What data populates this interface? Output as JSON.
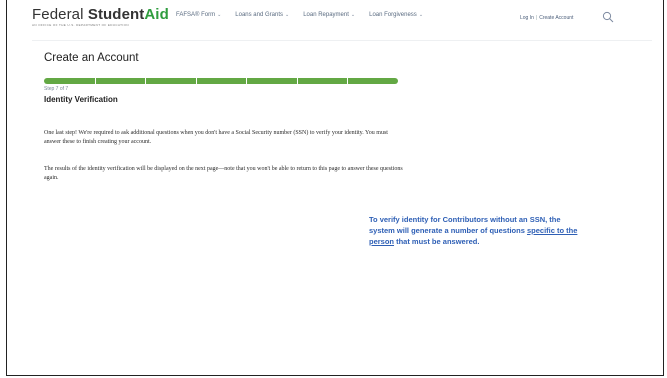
{
  "header": {
    "logo_part1": "Federal",
    "logo_part2": "Student",
    "logo_part3": "Aid",
    "logo_tagline": "AN OFFICE OF THE U.S. DEPARTMENT OF EDUCATION",
    "nav": [
      {
        "label": "FAFSA® Form"
      },
      {
        "label": "Loans and Grants"
      },
      {
        "label": "Loan Repayment"
      },
      {
        "label": "Loan Forgiveness"
      }
    ],
    "login_label": "Log In",
    "separator": "|",
    "create_account_label": "Create Account",
    "search_icon": "search-icon"
  },
  "page": {
    "title": "Create an Account",
    "progress": {
      "current": 7,
      "total": 7
    },
    "step_label": "Step 7 of 7",
    "section_title": "Identity Verification",
    "paragraph1": "One last step! We're required to ask additional questions when you don't have a Social Security number (SSN) to verify your identity. You must answer these to finish creating your account.",
    "paragraph2": "The results of the identity verification will be displayed on the next page—note that you won't be able to return to this page to answer these questions again."
  },
  "callout": {
    "text_before": "To verify identity for Contributors without an SSN, the system will generate a number of questions ",
    "text_underlined": "specific to the person",
    "text_after": " that must be answered.",
    "color": "#2e5fb5"
  },
  "colors": {
    "progress": "#63a844",
    "logo_accent": "#2f9d3e"
  }
}
